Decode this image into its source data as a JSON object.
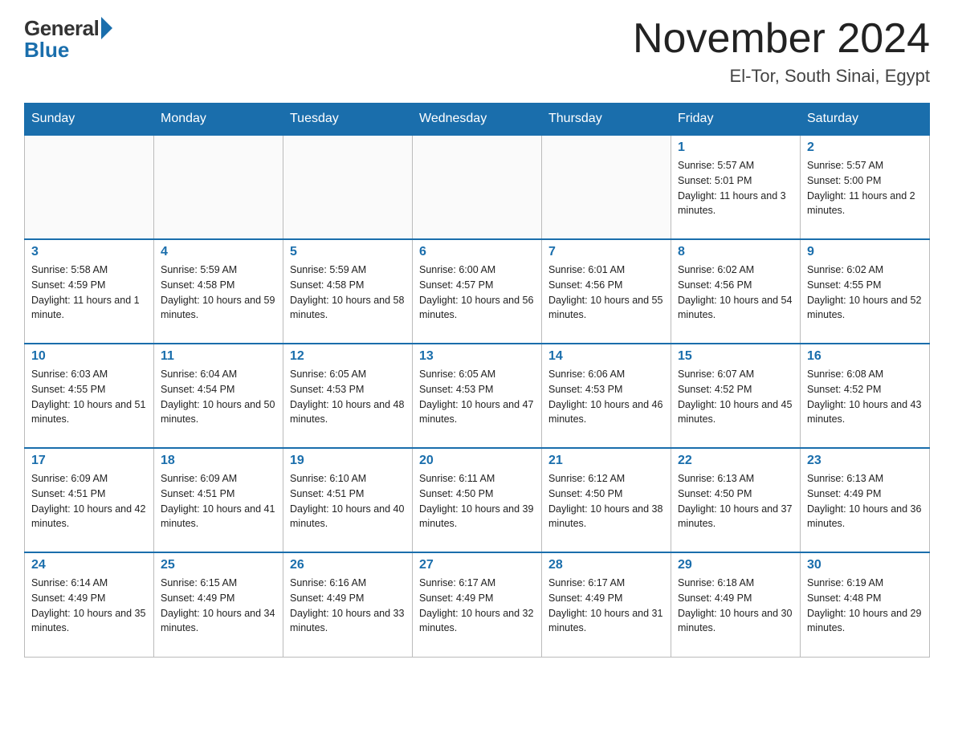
{
  "logo": {
    "general": "General",
    "blue": "Blue"
  },
  "title": {
    "main": "November 2024",
    "sub": "El-Tor, South Sinai, Egypt"
  },
  "days_header": [
    "Sunday",
    "Monday",
    "Tuesday",
    "Wednesday",
    "Thursday",
    "Friday",
    "Saturday"
  ],
  "weeks": [
    [
      {
        "day": "",
        "info": ""
      },
      {
        "day": "",
        "info": ""
      },
      {
        "day": "",
        "info": ""
      },
      {
        "day": "",
        "info": ""
      },
      {
        "day": "",
        "info": ""
      },
      {
        "day": "1",
        "info": "Sunrise: 5:57 AM\nSunset: 5:01 PM\nDaylight: 11 hours and 3 minutes."
      },
      {
        "day": "2",
        "info": "Sunrise: 5:57 AM\nSunset: 5:00 PM\nDaylight: 11 hours and 2 minutes."
      }
    ],
    [
      {
        "day": "3",
        "info": "Sunrise: 5:58 AM\nSunset: 4:59 PM\nDaylight: 11 hours and 1 minute."
      },
      {
        "day": "4",
        "info": "Sunrise: 5:59 AM\nSunset: 4:58 PM\nDaylight: 10 hours and 59 minutes."
      },
      {
        "day": "5",
        "info": "Sunrise: 5:59 AM\nSunset: 4:58 PM\nDaylight: 10 hours and 58 minutes."
      },
      {
        "day": "6",
        "info": "Sunrise: 6:00 AM\nSunset: 4:57 PM\nDaylight: 10 hours and 56 minutes."
      },
      {
        "day": "7",
        "info": "Sunrise: 6:01 AM\nSunset: 4:56 PM\nDaylight: 10 hours and 55 minutes."
      },
      {
        "day": "8",
        "info": "Sunrise: 6:02 AM\nSunset: 4:56 PM\nDaylight: 10 hours and 54 minutes."
      },
      {
        "day": "9",
        "info": "Sunrise: 6:02 AM\nSunset: 4:55 PM\nDaylight: 10 hours and 52 minutes."
      }
    ],
    [
      {
        "day": "10",
        "info": "Sunrise: 6:03 AM\nSunset: 4:55 PM\nDaylight: 10 hours and 51 minutes."
      },
      {
        "day": "11",
        "info": "Sunrise: 6:04 AM\nSunset: 4:54 PM\nDaylight: 10 hours and 50 minutes."
      },
      {
        "day": "12",
        "info": "Sunrise: 6:05 AM\nSunset: 4:53 PM\nDaylight: 10 hours and 48 minutes."
      },
      {
        "day": "13",
        "info": "Sunrise: 6:05 AM\nSunset: 4:53 PM\nDaylight: 10 hours and 47 minutes."
      },
      {
        "day": "14",
        "info": "Sunrise: 6:06 AM\nSunset: 4:53 PM\nDaylight: 10 hours and 46 minutes."
      },
      {
        "day": "15",
        "info": "Sunrise: 6:07 AM\nSunset: 4:52 PM\nDaylight: 10 hours and 45 minutes."
      },
      {
        "day": "16",
        "info": "Sunrise: 6:08 AM\nSunset: 4:52 PM\nDaylight: 10 hours and 43 minutes."
      }
    ],
    [
      {
        "day": "17",
        "info": "Sunrise: 6:09 AM\nSunset: 4:51 PM\nDaylight: 10 hours and 42 minutes."
      },
      {
        "day": "18",
        "info": "Sunrise: 6:09 AM\nSunset: 4:51 PM\nDaylight: 10 hours and 41 minutes."
      },
      {
        "day": "19",
        "info": "Sunrise: 6:10 AM\nSunset: 4:51 PM\nDaylight: 10 hours and 40 minutes."
      },
      {
        "day": "20",
        "info": "Sunrise: 6:11 AM\nSunset: 4:50 PM\nDaylight: 10 hours and 39 minutes."
      },
      {
        "day": "21",
        "info": "Sunrise: 6:12 AM\nSunset: 4:50 PM\nDaylight: 10 hours and 38 minutes."
      },
      {
        "day": "22",
        "info": "Sunrise: 6:13 AM\nSunset: 4:50 PM\nDaylight: 10 hours and 37 minutes."
      },
      {
        "day": "23",
        "info": "Sunrise: 6:13 AM\nSunset: 4:49 PM\nDaylight: 10 hours and 36 minutes."
      }
    ],
    [
      {
        "day": "24",
        "info": "Sunrise: 6:14 AM\nSunset: 4:49 PM\nDaylight: 10 hours and 35 minutes."
      },
      {
        "day": "25",
        "info": "Sunrise: 6:15 AM\nSunset: 4:49 PM\nDaylight: 10 hours and 34 minutes."
      },
      {
        "day": "26",
        "info": "Sunrise: 6:16 AM\nSunset: 4:49 PM\nDaylight: 10 hours and 33 minutes."
      },
      {
        "day": "27",
        "info": "Sunrise: 6:17 AM\nSunset: 4:49 PM\nDaylight: 10 hours and 32 minutes."
      },
      {
        "day": "28",
        "info": "Sunrise: 6:17 AM\nSunset: 4:49 PM\nDaylight: 10 hours and 31 minutes."
      },
      {
        "day": "29",
        "info": "Sunrise: 6:18 AM\nSunset: 4:49 PM\nDaylight: 10 hours and 30 minutes."
      },
      {
        "day": "30",
        "info": "Sunrise: 6:19 AM\nSunset: 4:48 PM\nDaylight: 10 hours and 29 minutes."
      }
    ]
  ]
}
